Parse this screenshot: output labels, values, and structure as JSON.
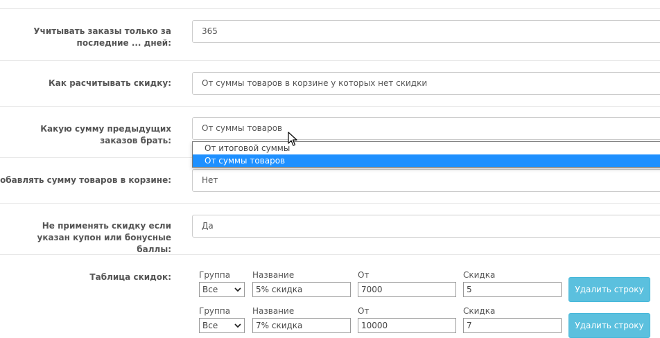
{
  "settings": [
    {
      "label": "Учитывать заказы только за последние ... дней:",
      "value": "365"
    },
    {
      "label": "Как расчитывать скидку:",
      "value": "От суммы товаров в корзине у которых нет скидки"
    },
    {
      "label": "Какую сумму предыдущих заказов брать:",
      "value": "От суммы товаров"
    },
    {
      "label": "Добавлять сумму товаров в корзине:",
      "value": "Нет"
    },
    {
      "label": "Не применять скидку если указан купон или бонусные баллы:",
      "value": "Да"
    }
  ],
  "dropdown": {
    "options": [
      "От итоговой суммы",
      "От суммы товаров"
    ],
    "selected_index": 1
  },
  "discount_table": {
    "label": "Таблица скидок:",
    "headers": {
      "group": "Группа",
      "name": "Название",
      "from": "От",
      "discount": "Скидка"
    },
    "rows": [
      {
        "group": "Все",
        "name": "5% скидка",
        "from": "7000",
        "discount": "5",
        "delete_label": "Удалить строку"
      },
      {
        "group": "Все",
        "name": "7% скидка",
        "from": "10000",
        "discount": "7",
        "delete_label": "Удалить строку"
      }
    ]
  }
}
